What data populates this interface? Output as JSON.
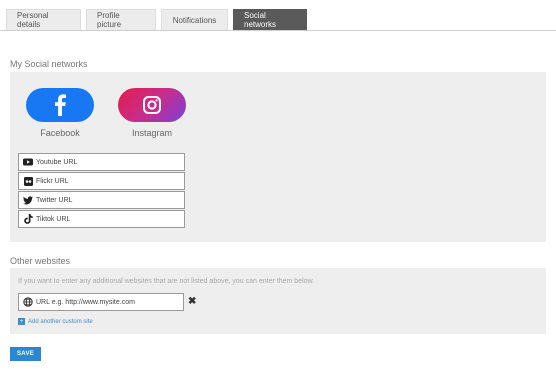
{
  "tabs": [
    {
      "label": "Personal details"
    },
    {
      "label": "Profile picture"
    },
    {
      "label": "Notifications"
    },
    {
      "label": "Social networks"
    }
  ],
  "social": {
    "title": "My Social networks",
    "networks": [
      {
        "label": "Facebook",
        "icon": "facebook-icon",
        "color": "#1877f2"
      },
      {
        "label": "Instagram",
        "icon": "instagram-icon",
        "color": "#d6266f"
      }
    ],
    "url_fields": [
      {
        "placeholder": "Youtube URL",
        "icon": "youtube-icon"
      },
      {
        "placeholder": "Flickr URL",
        "icon": "flickr-icon"
      },
      {
        "placeholder": "Twitter URL",
        "icon": "twitter-icon"
      },
      {
        "placeholder": "Tiktok URL",
        "icon": "tiktok-icon"
      }
    ]
  },
  "other": {
    "title": "Other websites",
    "hint": "If you want to enter any additional websites that are not listed above, you can enter them below.",
    "url_placeholder": "URL e.g. http://www.mysite.com",
    "remove_glyph": "✖",
    "add_label": "Add another custom site"
  },
  "save_label": "SAVE",
  "colors": {
    "accent": "#2a86d6",
    "active_tab": "#5a5a5a",
    "panel_bg": "#eeeeee"
  }
}
